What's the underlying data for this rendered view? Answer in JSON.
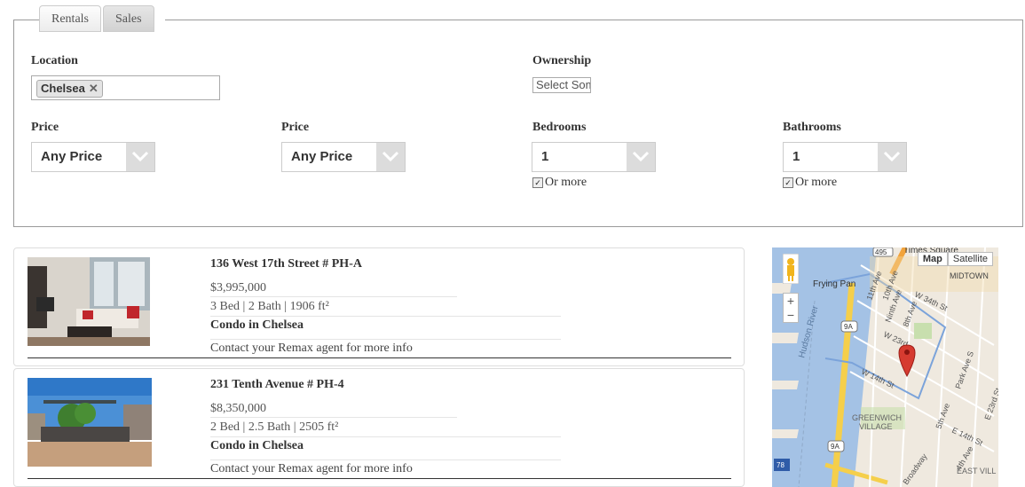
{
  "tabs": [
    {
      "label": "Rentals"
    },
    {
      "label": "Sales"
    }
  ],
  "filters": {
    "location_label": "Location",
    "location_chip": "Chelsea",
    "ownership_label": "Ownership",
    "ownership_placeholder": "Select Some Options",
    "price_min_label": "Price",
    "price_min_value": "Any Price",
    "price_max_label": "Price",
    "price_max_value": "Any Price",
    "bedrooms_label": "Bedrooms",
    "bedrooms_value": "1",
    "bedrooms_or_more": "Or more",
    "bathrooms_label": "Bathrooms",
    "bathrooms_value": "1",
    "bathrooms_or_more": "Or more"
  },
  "listings": [
    {
      "title": "136 West 17th Street # PH-A",
      "price": "$3,995,000",
      "specs": "3 Bed | 2 Bath | 1906 ft²",
      "type": "Condo in Chelsea",
      "contact": "Contact your Remax agent for more info"
    },
    {
      "title": "231 Tenth Avenue # PH-4",
      "price": "$8,350,000",
      "specs": "2 Bed | 2.5 Bath | 2505 ft²",
      "type": "Condo in Chelsea",
      "contact": "Contact your Remax agent for more info"
    }
  ],
  "map": {
    "btn_map": "Map",
    "btn_satellite": "Satellite",
    "labels": {
      "times_square": "Times Square",
      "midtown": "MIDTOWN",
      "frying_pan": "Frying Pan",
      "hudson_river": "Hudson River",
      "w34": "W 34th St",
      "w23": "W 23rd",
      "w14": "W 14th St",
      "ninth_ave": "Ninth Ave",
      "eighth_ave": "8th Ave",
      "tenth_ave": "10th Ave",
      "eleventh_ave": "11th Ave",
      "fifth_ave": "5th Ave",
      "greenwich": "GREENWICH",
      "village": "VILLAGE",
      "park_ave": "Park Ave S",
      "e14": "E 14th St",
      "e23": "E 23rd St",
      "fourth_ave": "4th Ave",
      "broadway": "Broadway",
      "east_village": "EAST VILL",
      "r9a": "9A",
      "r495": "495",
      "r78": "78",
      "zoom_in": "+",
      "zoom_out": "−"
    }
  }
}
